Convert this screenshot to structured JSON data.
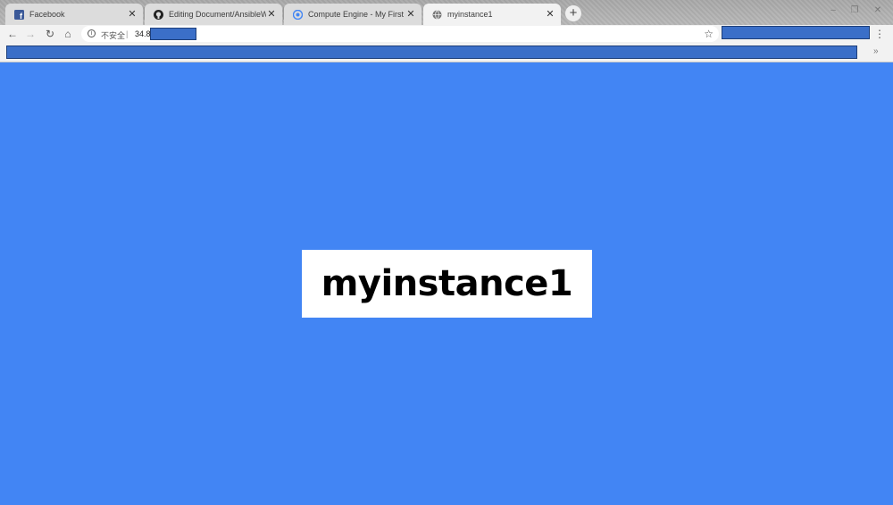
{
  "tabs": [
    {
      "title": "Facebook",
      "icon": "facebook-icon",
      "active": false
    },
    {
      "title": "Editing Document/AnsibleWith",
      "icon": "github-icon",
      "active": false
    },
    {
      "title": "Compute Engine - My First Pro",
      "icon": "compute-engine-icon",
      "active": false
    },
    {
      "title": "myinstance1",
      "icon": "globe-icon",
      "active": true
    }
  ],
  "omnibox": {
    "security_label": "不安全",
    "url_visible": "34.8"
  },
  "page": {
    "heading": "myinstance1"
  },
  "colors": {
    "page_background": "#4285f4",
    "redaction": "#3b6fc8"
  }
}
